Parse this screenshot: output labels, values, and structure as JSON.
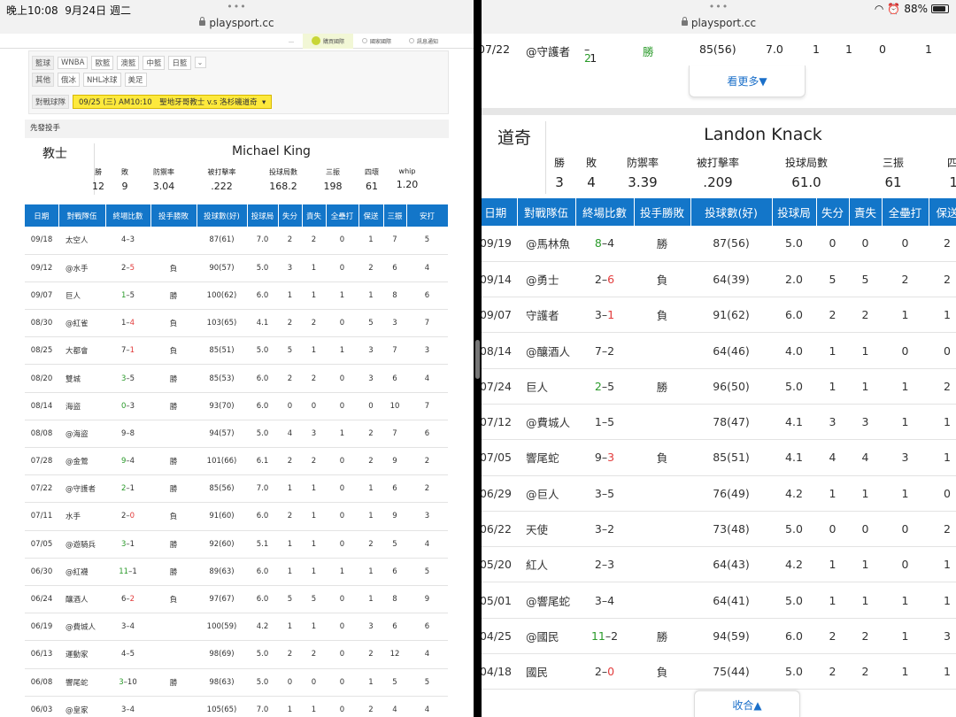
{
  "status": {
    "time": "晚上10:08",
    "date": "9月24日 週二",
    "battery": "88%"
  },
  "left": {
    "url": "playsport.cc",
    "nav": [
      "…",
      "購買國際",
      "國家國際",
      "訊息通知"
    ],
    "filter": {
      "rows": [
        {
          "label": "籃球",
          "chips": [
            "WNBA",
            "歐籃",
            "澳籃",
            "中籃",
            "日籃"
          ]
        },
        {
          "label": "其他",
          "chips": [
            "俄冰",
            "NHL冰球",
            "美足"
          ]
        }
      ],
      "match_label": "對戰球隊",
      "match_value": "09/25 (三) AM10:10　聖地牙哥教士 v.s 洛杉磯道奇"
    },
    "section_title": "先發投手",
    "team": "教士",
    "pitcher": "Michael King",
    "stats": [
      {
        "label": "勝",
        "value": "12"
      },
      {
        "label": "敗",
        "value": "9"
      },
      {
        "label": "防禦率",
        "value": "3.04"
      },
      {
        "label": "被打擊率",
        "value": ".222"
      },
      {
        "label": "投球局數",
        "value": "168.2"
      },
      {
        "label": "三振",
        "value": "198"
      },
      {
        "label": "四壞",
        "value": "61"
      },
      {
        "label": "whip",
        "value": "1.20"
      }
    ],
    "headers": [
      "日期",
      "對戰隊伍",
      "終場比數",
      "投手勝敗",
      "投球數(好)",
      "投球局",
      "失分",
      "責失",
      "全壘打",
      "保送",
      "三振",
      "安打"
    ],
    "rows": [
      {
        "date": "09/18",
        "opp": "太空人",
        "s1": "4",
        "s2": "3",
        "w": "",
        "res": "",
        "p": "87(61)",
        "ip": "7.0",
        "r": "2",
        "er": "2",
        "hr": "0",
        "bb": "1",
        "k": "7",
        "h": "5"
      },
      {
        "date": "09/12",
        "opp": "@水手",
        "s1": "2",
        "s2": "5",
        "w": "r",
        "res": "負",
        "p": "90(57)",
        "ip": "5.0",
        "r": "3",
        "er": "1",
        "hr": "0",
        "bb": "2",
        "k": "6",
        "h": "4"
      },
      {
        "date": "09/07",
        "opp": "巨人",
        "s1": "1",
        "s2": "5",
        "w": "g",
        "res": "勝",
        "p": "100(62)",
        "ip": "6.0",
        "r": "1",
        "er": "1",
        "hr": "1",
        "bb": "1",
        "k": "8",
        "h": "6"
      },
      {
        "date": "08/30",
        "opp": "@紅雀",
        "s1": "1",
        "s2": "4",
        "w": "r",
        "res": "負",
        "p": "103(65)",
        "ip": "4.1",
        "r": "2",
        "er": "2",
        "hr": "0",
        "bb": "5",
        "k": "3",
        "h": "7"
      },
      {
        "date": "08/25",
        "opp": "大都會",
        "s1": "7",
        "s2": "1",
        "w": "r",
        "res": "負",
        "p": "85(51)",
        "ip": "5.0",
        "r": "5",
        "er": "1",
        "hr": "1",
        "bb": "3",
        "k": "7",
        "h": "3"
      },
      {
        "date": "08/20",
        "opp": "雙城",
        "s1": "3",
        "s2": "5",
        "w": "g",
        "res": "勝",
        "p": "85(53)",
        "ip": "6.0",
        "r": "2",
        "er": "2",
        "hr": "0",
        "bb": "3",
        "k": "6",
        "h": "4"
      },
      {
        "date": "08/14",
        "opp": "海盜",
        "s1": "0",
        "s2": "3",
        "w": "g",
        "res": "勝",
        "p": "93(70)",
        "ip": "6.0",
        "r": "0",
        "er": "0",
        "hr": "0",
        "bb": "0",
        "k": "10",
        "h": "7"
      },
      {
        "date": "08/08",
        "opp": "@海盜",
        "s1": "9",
        "s2": "8",
        "w": "",
        "res": "",
        "p": "94(57)",
        "ip": "5.0",
        "r": "4",
        "er": "3",
        "hr": "1",
        "bb": "2",
        "k": "7",
        "h": "6"
      },
      {
        "date": "07/28",
        "opp": "@金鶯",
        "s1": "9",
        "s2": "4",
        "w": "g",
        "res": "勝",
        "p": "101(66)",
        "ip": "6.1",
        "r": "2",
        "er": "2",
        "hr": "0",
        "bb": "2",
        "k": "9",
        "h": "2"
      },
      {
        "date": "07/22",
        "opp": "@守護者",
        "s1": "2",
        "s2": "1",
        "w": "g",
        "res": "勝",
        "p": "85(56)",
        "ip": "7.0",
        "r": "1",
        "er": "1",
        "hr": "0",
        "bb": "1",
        "k": "6",
        "h": "2"
      },
      {
        "date": "07/11",
        "opp": "水手",
        "s1": "2",
        "s2": "0",
        "w": "r",
        "res": "負",
        "p": "91(60)",
        "ip": "6.0",
        "r": "2",
        "er": "1",
        "hr": "0",
        "bb": "1",
        "k": "9",
        "h": "3"
      },
      {
        "date": "07/05",
        "opp": "@遊騎兵",
        "s1": "3",
        "s2": "1",
        "w": "g",
        "res": "勝",
        "p": "92(60)",
        "ip": "5.1",
        "r": "1",
        "er": "1",
        "hr": "0",
        "bb": "2",
        "k": "5",
        "h": "4"
      },
      {
        "date": "06/30",
        "opp": "@紅襪",
        "s1": "11",
        "s2": "1",
        "w": "g",
        "res": "勝",
        "p": "89(63)",
        "ip": "6.0",
        "r": "1",
        "er": "1",
        "hr": "1",
        "bb": "1",
        "k": "6",
        "h": "5"
      },
      {
        "date": "06/24",
        "opp": "釀酒人",
        "s1": "6",
        "s2": "2",
        "w": "r",
        "res": "負",
        "p": "97(67)",
        "ip": "6.0",
        "r": "5",
        "er": "5",
        "hr": "0",
        "bb": "1",
        "k": "8",
        "h": "9"
      },
      {
        "date": "06/19",
        "opp": "@費城人",
        "s1": "3",
        "s2": "4",
        "w": "",
        "res": "",
        "p": "100(59)",
        "ip": "4.2",
        "r": "1",
        "er": "1",
        "hr": "0",
        "bb": "3",
        "k": "6",
        "h": "6"
      },
      {
        "date": "06/13",
        "opp": "運動家",
        "s1": "4",
        "s2": "5",
        "w": "",
        "res": "",
        "p": "98(69)",
        "ip": "5.0",
        "r": "2",
        "er": "2",
        "hr": "0",
        "bb": "2",
        "k": "12",
        "h": "4"
      },
      {
        "date": "06/08",
        "opp": "響尾蛇",
        "s1": "3",
        "s2": "10",
        "w": "g",
        "res": "勝",
        "p": "98(63)",
        "ip": "5.0",
        "r": "0",
        "er": "0",
        "hr": "0",
        "bb": "1",
        "k": "5",
        "h": "5"
      },
      {
        "date": "06/03",
        "opp": "@皇家",
        "s1": "3",
        "s2": "4",
        "w": "",
        "res": "",
        "p": "105(65)",
        "ip": "7.0",
        "r": "1",
        "er": "1",
        "hr": "0",
        "bb": "2",
        "k": "4",
        "h": "4"
      }
    ]
  },
  "right": {
    "url": "playsport.cc",
    "top_row": {
      "date": "07/22",
      "opp": "@守護者",
      "s1": "2",
      "s2": "1",
      "res": "勝",
      "p": "85(56)",
      "ip": "7.0",
      "r": "1",
      "er": "1",
      "hr": "0",
      "bb": "1"
    },
    "more": "看更多▼",
    "team": "道奇",
    "pitcher": "Landon Knack",
    "stats": [
      {
        "label": "勝",
        "value": "3"
      },
      {
        "label": "敗",
        "value": "4"
      },
      {
        "label": "防禦率",
        "value": "3.39"
      },
      {
        "label": "被打擊率",
        "value": ".209"
      },
      {
        "label": "投球局數",
        "value": "61.0"
      },
      {
        "label": "三振",
        "value": "61"
      },
      {
        "label": "四壞",
        "value": "17"
      }
    ],
    "headers": [
      "日期",
      "對戰隊伍",
      "終場比數",
      "投手勝敗",
      "投球數(好)",
      "投球局",
      "失分",
      "責失",
      "全壘打",
      "保送"
    ],
    "rows": [
      {
        "date": "09/19",
        "opp": "@馬林魚",
        "s1": "8",
        "s2": "4",
        "w": "g",
        "res": "勝",
        "p": "87(56)",
        "ip": "5.0",
        "r": "0",
        "er": "0",
        "hr": "0",
        "bb": "2"
      },
      {
        "date": "09/14",
        "opp": "@勇士",
        "s1": "2",
        "s2": "6",
        "w": "r",
        "res": "負",
        "p": "64(39)",
        "ip": "2.0",
        "r": "5",
        "er": "5",
        "hr": "2",
        "bb": "2"
      },
      {
        "date": "09/07",
        "opp": "守護者",
        "s1": "3",
        "s2": "1",
        "w": "r",
        "res": "負",
        "p": "91(62)",
        "ip": "6.0",
        "r": "2",
        "er": "2",
        "hr": "1",
        "bb": "1"
      },
      {
        "date": "08/14",
        "opp": "@釀酒人",
        "s1": "7",
        "s2": "2",
        "w": "",
        "res": "",
        "p": "64(46)",
        "ip": "4.0",
        "r": "1",
        "er": "1",
        "hr": "0",
        "bb": "0"
      },
      {
        "date": "07/24",
        "opp": "巨人",
        "s1": "2",
        "s2": "5",
        "w": "g",
        "res": "勝",
        "p": "96(50)",
        "ip": "5.0",
        "r": "1",
        "er": "1",
        "hr": "1",
        "bb": "2"
      },
      {
        "date": "07/12",
        "opp": "@費城人",
        "s1": "1",
        "s2": "5",
        "w": "",
        "res": "",
        "p": "78(47)",
        "ip": "4.1",
        "r": "3",
        "er": "3",
        "hr": "1",
        "bb": "1"
      },
      {
        "date": "07/05",
        "opp": "響尾蛇",
        "s1": "9",
        "s2": "3",
        "w": "r",
        "res": "負",
        "p": "85(51)",
        "ip": "4.1",
        "r": "4",
        "er": "4",
        "hr": "3",
        "bb": "1"
      },
      {
        "date": "06/29",
        "opp": "@巨人",
        "s1": "3",
        "s2": "5",
        "w": "",
        "res": "",
        "p": "76(49)",
        "ip": "4.2",
        "r": "1",
        "er": "1",
        "hr": "1",
        "bb": "0"
      },
      {
        "date": "06/22",
        "opp": "天使",
        "s1": "3",
        "s2": "2",
        "w": "",
        "res": "",
        "p": "73(48)",
        "ip": "5.0",
        "r": "0",
        "er": "0",
        "hr": "0",
        "bb": "2"
      },
      {
        "date": "05/20",
        "opp": "紅人",
        "s1": "2",
        "s2": "3",
        "w": "",
        "res": "",
        "p": "64(43)",
        "ip": "4.2",
        "r": "1",
        "er": "1",
        "hr": "0",
        "bb": "1"
      },
      {
        "date": "05/01",
        "opp": "@響尾蛇",
        "s1": "3",
        "s2": "4",
        "w": "",
        "res": "",
        "p": "64(41)",
        "ip": "5.0",
        "r": "1",
        "er": "1",
        "hr": "1",
        "bb": "1"
      },
      {
        "date": "04/25",
        "opp": "@國民",
        "s1": "11",
        "s2": "2",
        "w": "g",
        "res": "勝",
        "p": "94(59)",
        "ip": "6.0",
        "r": "2",
        "er": "2",
        "hr": "1",
        "bb": "3"
      },
      {
        "date": "04/18",
        "opp": "國民",
        "s1": "2",
        "s2": "0",
        "w": "r",
        "res": "負",
        "p": "75(44)",
        "ip": "5.0",
        "r": "2",
        "er": "2",
        "hr": "1",
        "bb": "1"
      }
    ],
    "collapse": "收合▲"
  }
}
